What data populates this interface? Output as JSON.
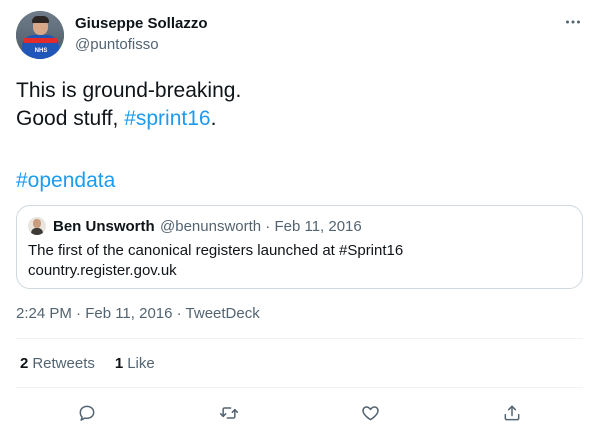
{
  "author": {
    "display_name": "Giuseppe Sollazzo",
    "handle": "@puntofisso",
    "avatar_badge": "NHS"
  },
  "tweet": {
    "line1": "This is ground-breaking.",
    "line2_prefix": "Good stuff, ",
    "line2_hashtag": "#sprint16",
    "line2_suffix": ".",
    "hashtag_line": "#opendata"
  },
  "quote": {
    "display_name": "Ben Unsworth",
    "meta": "@benunsworth · Feb 11, 2016",
    "text_line1": "The first of the canonical registers launched at #Sprint16",
    "text_line2": "country.register.gov.uk"
  },
  "timestamp": "2:24 PM · Feb 11, 2016 · TweetDeck",
  "stats": {
    "retweets_count": "2",
    "retweets_label": "Retweets",
    "likes_count": "1",
    "likes_label": "Like"
  },
  "colors": {
    "link": "#1d9bf0",
    "secondary_text": "#536471",
    "primary_text": "#0f1419",
    "border": "#cfd9de"
  },
  "icons": {
    "more": "more-horizontal-icon",
    "reply": "reply-icon",
    "retweet": "retweet-icon",
    "like": "heart-icon",
    "share": "share-icon"
  }
}
